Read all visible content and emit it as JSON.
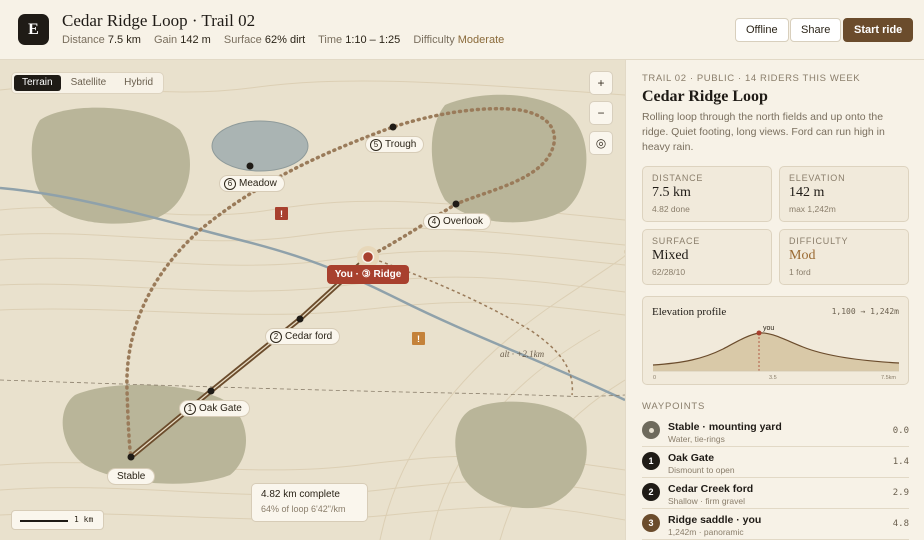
{
  "header": {
    "logo": "E",
    "title": "Cedar Ridge Loop · Trail 02",
    "meta": [
      {
        "label": "Distance",
        "value": "7.5 km"
      },
      {
        "label": "Gain",
        "value": "142 m"
      },
      {
        "label": "Surface",
        "value": "62% dirt"
      },
      {
        "label": "Time",
        "value": "1:10 – 1:25"
      },
      {
        "label": "Difficulty",
        "value": "Moderate"
      }
    ],
    "buttons": {
      "offline": "Offline",
      "share": "Share",
      "start": "Start ride"
    }
  },
  "map": {
    "view_modes": [
      "Terrain",
      "Satellite",
      "Hybrid"
    ],
    "active_view": "Terrain",
    "controls": {
      "zoom_in": "+",
      "zoom_out": "−",
      "locate": "◎"
    },
    "waypoints": [
      {
        "num": "1",
        "label": "Oak Gate"
      },
      {
        "num": "2",
        "label": "Cedar ford"
      },
      {
        "num": "4",
        "label": "Overlook"
      },
      {
        "num": "5",
        "label": "Trough"
      },
      {
        "num": "6",
        "label": "Meadow"
      }
    ],
    "start_label": "Stable",
    "you_label": "You · ③ Ridge",
    "warning_glyph": "!",
    "alt_route": "alt · +2.1km",
    "scale": "1 km",
    "progress": {
      "complete": "4.82 km complete",
      "detail": "64% of loop  6'42\"/km"
    },
    "colors": {
      "route": "#8a6a4a",
      "you": "#a8402e",
      "river": "#8fa1aa",
      "forest": "#b9b599",
      "water": "#aab4b3"
    }
  },
  "panel": {
    "kicker": "TRAIL 02 · PUBLIC · 14 RIDERS THIS WEEK",
    "title": "Cedar Ridge Loop",
    "description": "Rolling loop through the north fields and up onto the ridge. Quiet footing, long views. Ford can run high in heavy rain.",
    "stats": [
      {
        "key": "DISTANCE",
        "value": "7.5 km",
        "sub": "4.82 done"
      },
      {
        "key": "ELEVATION",
        "value": "142 m",
        "sub": "max 1,242m"
      },
      {
        "key": "SURFACE",
        "value": "Mixed",
        "sub": "62/28/10"
      },
      {
        "key": "DIFFICULTY",
        "value": "Mod",
        "sub": "1 ford"
      }
    ],
    "elevation": {
      "title": "Elevation profile",
      "range": "1,100 → 1,242m",
      "you_marker": "you",
      "ticks": [
        "0",
        "3.5",
        "7.5km"
      ]
    },
    "waypoints_heading": "WAYPOINTS",
    "waypoints": [
      {
        "badge": "",
        "name": "Stable · mounting yard",
        "detail": "Water, tie-rings",
        "km": "0.0"
      },
      {
        "badge": "1",
        "name": "Oak Gate",
        "detail": "Dismount to open",
        "km": "1.4"
      },
      {
        "badge": "2",
        "name": "Cedar Creek ford",
        "detail": "Shallow · firm gravel",
        "km": "2.9"
      },
      {
        "badge": "3",
        "name": "Ridge saddle · you",
        "detail": "1,242m · panoramic",
        "km": "4.8"
      }
    ]
  }
}
